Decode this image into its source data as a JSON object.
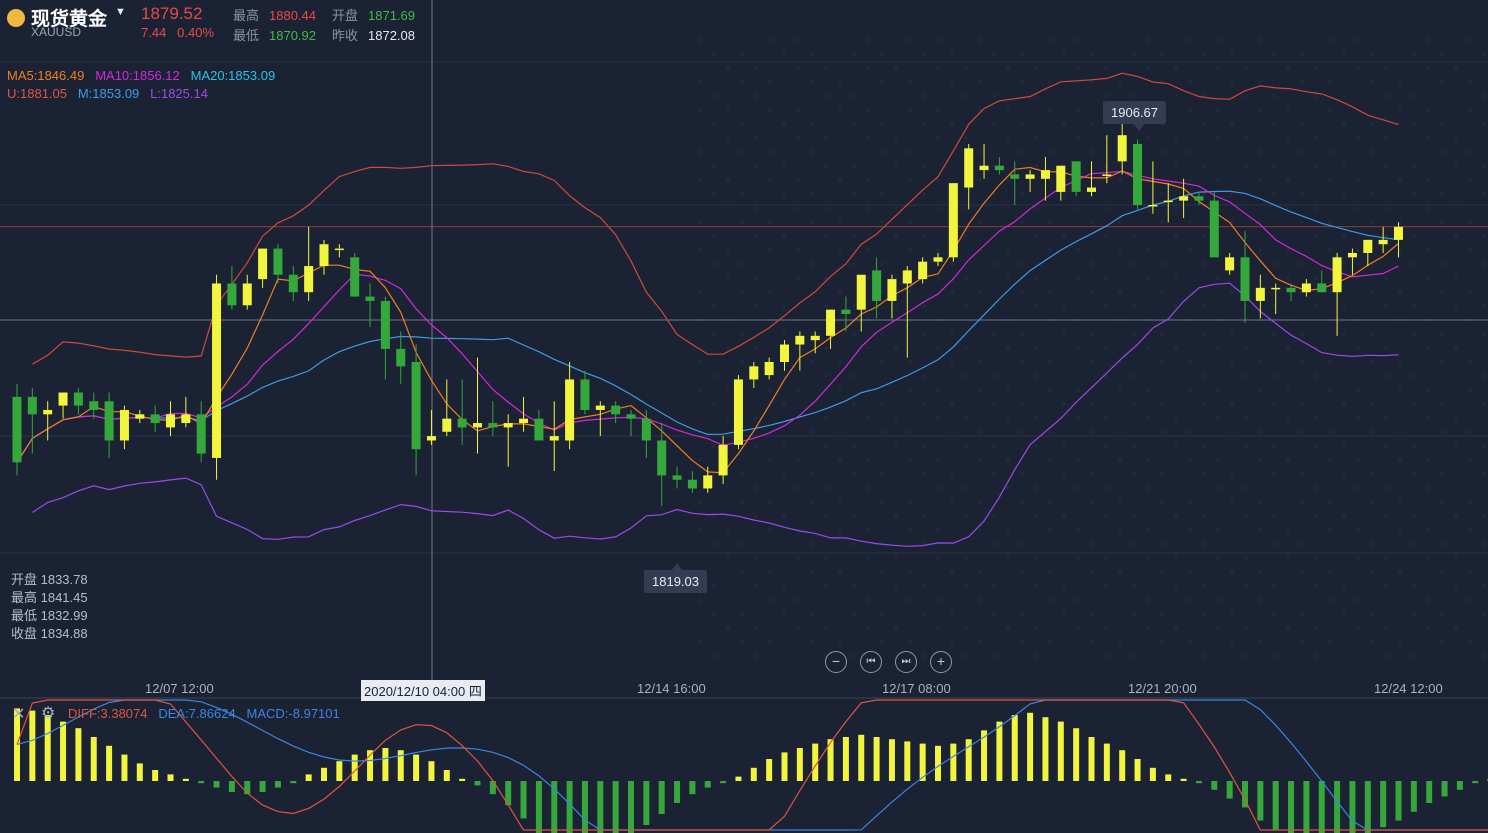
{
  "header": {
    "name": "现货黄金",
    "code": "XAUUSD",
    "price": "1879.52",
    "change": "7.44",
    "change_pct": "0.40%",
    "high_label": "最高",
    "high": "1880.44",
    "open_label": "开盘",
    "open": "1871.69",
    "low_label": "最低",
    "low": "1870.92",
    "prev_label": "昨收",
    "prev": "1872.08"
  },
  "indicators": {
    "ma5": "MA5:1846.49",
    "ma10": "MA10:1856.12",
    "ma20": "MA20:1853.09",
    "upper": "U:1881.05",
    "mid": "M:1853.09",
    "lower": "L:1825.14"
  },
  "crosshair_ohlc": {
    "open": "开盘 1833.78",
    "high": "最高 1841.45",
    "low": "最低 1832.99",
    "close": "收盘 1834.88"
  },
  "callouts": {
    "max": "1906.67",
    "min": "1819.03"
  },
  "x_ticks": [
    "12/07 12:00",
    "2020/12/10 04:00 四",
    "12/14 16:00",
    "12/17 08:00",
    "12/21 20:00",
    "12/24 12:00"
  ],
  "macd": {
    "diff": "DIFF:3.38074",
    "dea": "DEA:7.86624",
    "macd": "MACD:-8.97101"
  },
  "colors": {
    "background": "#1b2234",
    "up": "#f2f53d",
    "down": "#35a83c",
    "ma5": "#f07f1f",
    "ma10": "#d02ad6",
    "ma20": "#3d9be5",
    "upper": "#d04a3a",
    "lower": "#9b4be8",
    "diff": "#e0553f",
    "dea": "#3a86e0"
  },
  "chart_data": {
    "type": "candlestick",
    "symbol": "XAUUSD",
    "y_range": [
      1780,
      1935
    ],
    "candles": [
      {
        "o": 1844,
        "h": 1847,
        "l": 1826,
        "c": 1829
      },
      {
        "o": 1844,
        "h": 1846,
        "l": 1831,
        "c": 1840
      },
      {
        "o": 1840,
        "h": 1843,
        "l": 1834,
        "c": 1841
      },
      {
        "o": 1842,
        "h": 1845,
        "l": 1839,
        "c": 1845
      },
      {
        "o": 1845,
        "h": 1846,
        "l": 1840,
        "c": 1842
      },
      {
        "o": 1843,
        "h": 1845,
        "l": 1839,
        "c": 1841
      },
      {
        "o": 1843,
        "h": 1845,
        "l": 1830,
        "c": 1834
      },
      {
        "o": 1834,
        "h": 1842,
        "l": 1832,
        "c": 1841
      },
      {
        "o": 1839,
        "h": 1841,
        "l": 1838,
        "c": 1840
      },
      {
        "o": 1840,
        "h": 1842,
        "l": 1836,
        "c": 1838
      },
      {
        "o": 1837,
        "h": 1843,
        "l": 1835,
        "c": 1840
      },
      {
        "o": 1838,
        "h": 1844,
        "l": 1837,
        "c": 1840
      },
      {
        "o": 1840,
        "h": 1843,
        "l": 1829,
        "c": 1831
      },
      {
        "o": 1830,
        "h": 1872,
        "l": 1825,
        "c": 1870
      },
      {
        "o": 1870,
        "h": 1874,
        "l": 1864,
        "c": 1865
      },
      {
        "o": 1865,
        "h": 1872,
        "l": 1864,
        "c": 1870
      },
      {
        "o": 1871,
        "h": 1878,
        "l": 1869,
        "c": 1878
      },
      {
        "o": 1878,
        "h": 1879,
        "l": 1870,
        "c": 1872
      },
      {
        "o": 1872,
        "h": 1874,
        "l": 1866,
        "c": 1868
      },
      {
        "o": 1868,
        "h": 1883,
        "l": 1866,
        "c": 1874
      },
      {
        "o": 1874,
        "h": 1880,
        "l": 1872,
        "c": 1879
      },
      {
        "o": 1878,
        "h": 1879,
        "l": 1876,
        "c": 1878
      },
      {
        "o": 1876,
        "h": 1877,
        "l": 1869,
        "c": 1867
      },
      {
        "o": 1867,
        "h": 1870,
        "l": 1860,
        "c": 1866
      },
      {
        "o": 1866,
        "h": 1867,
        "l": 1848,
        "c": 1855
      },
      {
        "o": 1855,
        "h": 1859,
        "l": 1847,
        "c": 1851
      },
      {
        "o": 1852,
        "h": 1856,
        "l": 1826,
        "c": 1832
      },
      {
        "o": 1834,
        "h": 1841,
        "l": 1833,
        "c": 1835
      },
      {
        "o": 1836,
        "h": 1848,
        "l": 1835,
        "c": 1839
      },
      {
        "o": 1839,
        "h": 1848,
        "l": 1833,
        "c": 1837
      },
      {
        "o": 1837,
        "h": 1853,
        "l": 1831,
        "c": 1838
      },
      {
        "o": 1838,
        "h": 1843,
        "l": 1835,
        "c": 1837
      },
      {
        "o": 1837,
        "h": 1840,
        "l": 1828,
        "c": 1838
      },
      {
        "o": 1838,
        "h": 1844,
        "l": 1836,
        "c": 1839
      },
      {
        "o": 1839,
        "h": 1841,
        "l": 1834,
        "c": 1834
      },
      {
        "o": 1834,
        "h": 1843,
        "l": 1827,
        "c": 1835
      },
      {
        "o": 1834,
        "h": 1852,
        "l": 1832,
        "c": 1848
      },
      {
        "o": 1848,
        "h": 1850,
        "l": 1840,
        "c": 1841
      },
      {
        "o": 1841,
        "h": 1843,
        "l": 1835,
        "c": 1842
      },
      {
        "o": 1842,
        "h": 1843,
        "l": 1838,
        "c": 1840
      },
      {
        "o": 1840,
        "h": 1841,
        "l": 1835,
        "c": 1839
      },
      {
        "o": 1839,
        "h": 1841,
        "l": 1830,
        "c": 1834
      },
      {
        "o": 1834,
        "h": 1838,
        "l": 1819,
        "c": 1826
      },
      {
        "o": 1826,
        "h": 1828,
        "l": 1823,
        "c": 1825
      },
      {
        "o": 1825,
        "h": 1827,
        "l": 1822,
        "c": 1823
      },
      {
        "o": 1823,
        "h": 1828,
        "l": 1822,
        "c": 1826
      },
      {
        "o": 1826,
        "h": 1835,
        "l": 1824,
        "c": 1833
      },
      {
        "o": 1833,
        "h": 1849,
        "l": 1832,
        "c": 1848
      },
      {
        "o": 1848,
        "h": 1852,
        "l": 1846,
        "c": 1851
      },
      {
        "o": 1849,
        "h": 1853,
        "l": 1848,
        "c": 1852
      },
      {
        "o": 1852,
        "h": 1857,
        "l": 1850,
        "c": 1856
      },
      {
        "o": 1856,
        "h": 1859,
        "l": 1850,
        "c": 1858
      },
      {
        "o": 1857,
        "h": 1859,
        "l": 1854,
        "c": 1858
      },
      {
        "o": 1858,
        "h": 1864,
        "l": 1855,
        "c": 1864
      },
      {
        "o": 1864,
        "h": 1867,
        "l": 1859,
        "c": 1863
      },
      {
        "o": 1864,
        "h": 1872,
        "l": 1859,
        "c": 1872
      },
      {
        "o": 1873,
        "h": 1876,
        "l": 1862,
        "c": 1866
      },
      {
        "o": 1866,
        "h": 1872,
        "l": 1862,
        "c": 1871
      },
      {
        "o": 1870,
        "h": 1874,
        "l": 1853,
        "c": 1873
      },
      {
        "o": 1871,
        "h": 1876,
        "l": 1870,
        "c": 1875
      },
      {
        "o": 1875,
        "h": 1877,
        "l": 1874,
        "c": 1876
      },
      {
        "o": 1876,
        "h": 1893,
        "l": 1875,
        "c": 1893
      },
      {
        "o": 1892,
        "h": 1902,
        "l": 1887,
        "c": 1901
      },
      {
        "o": 1896,
        "h": 1902,
        "l": 1894,
        "c": 1897
      },
      {
        "o": 1897,
        "h": 1899,
        "l": 1895,
        "c": 1896
      },
      {
        "o": 1895,
        "h": 1898,
        "l": 1888,
        "c": 1894
      },
      {
        "o": 1894,
        "h": 1896,
        "l": 1891,
        "c": 1895
      },
      {
        "o": 1894,
        "h": 1899,
        "l": 1889,
        "c": 1896
      },
      {
        "o": 1891,
        "h": 1897,
        "l": 1889,
        "c": 1897
      },
      {
        "o": 1898,
        "h": 1898,
        "l": 1890,
        "c": 1891
      },
      {
        "o": 1891,
        "h": 1898,
        "l": 1890,
        "c": 1892
      },
      {
        "o": 1895,
        "h": 1904,
        "l": 1893,
        "c": 1895
      },
      {
        "o": 1898,
        "h": 1907,
        "l": 1895,
        "c": 1904
      },
      {
        "o": 1902,
        "h": 1903,
        "l": 1887,
        "c": 1888
      },
      {
        "o": 1888,
        "h": 1898,
        "l": 1886,
        "c": 1888
      },
      {
        "o": 1889,
        "h": 1893,
        "l": 1884,
        "c": 1889
      },
      {
        "o": 1889,
        "h": 1894,
        "l": 1885,
        "c": 1890
      },
      {
        "o": 1890,
        "h": 1891,
        "l": 1888,
        "c": 1889
      },
      {
        "o": 1889,
        "h": 1891,
        "l": 1876,
        "c": 1876
      },
      {
        "o": 1873,
        "h": 1877,
        "l": 1872,
        "c": 1876
      },
      {
        "o": 1876,
        "h": 1882,
        "l": 1861,
        "c": 1866
      },
      {
        "o": 1866,
        "h": 1872,
        "l": 1862,
        "c": 1869
      },
      {
        "o": 1869,
        "h": 1870,
        "l": 1863,
        "c": 1869
      },
      {
        "o": 1869,
        "h": 1870,
        "l": 1866,
        "c": 1868
      },
      {
        "o": 1868,
        "h": 1871,
        "l": 1867,
        "c": 1870
      },
      {
        "o": 1870,
        "h": 1873,
        "l": 1868,
        "c": 1868
      },
      {
        "o": 1868,
        "h": 1877,
        "l": 1858,
        "c": 1876
      },
      {
        "o": 1876,
        "h": 1878,
        "l": 1872,
        "c": 1877
      },
      {
        "o": 1877,
        "h": 1880,
        "l": 1874,
        "c": 1880
      },
      {
        "o": 1879,
        "h": 1883,
        "l": 1877,
        "c": 1880
      },
      {
        "o": 1880,
        "h": 1884,
        "l": 1876,
        "c": 1883
      }
    ],
    "macd_hist": [
      33,
      32,
      30,
      27,
      24,
      20,
      16,
      12,
      8,
      5,
      3,
      1,
      -1,
      -3,
      -5,
      -6,
      -5,
      -3,
      -1,
      3,
      6,
      9,
      12,
      14,
      15,
      14,
      12,
      9,
      5,
      1,
      -2,
      -6,
      -11,
      -17,
      -24,
      -27,
      -29,
      -30,
      -30,
      -27,
      -24,
      -20,
      -15,
      -10,
      -6,
      -3,
      -1,
      2,
      6,
      10,
      13,
      15,
      17,
      19,
      20,
      21,
      20,
      19,
      18,
      17,
      16,
      17,
      19,
      23,
      27,
      30,
      31,
      29,
      27,
      24,
      20,
      17,
      14,
      10,
      6,
      3,
      1,
      -1,
      -4,
      -8,
      -12,
      -18,
      -22,
      -26,
      -28,
      -29,
      -30,
      -28,
      -25,
      -21,
      -18,
      -14,
      -10,
      -7,
      -4,
      -1,
      1,
      2,
      3,
      5
    ]
  }
}
